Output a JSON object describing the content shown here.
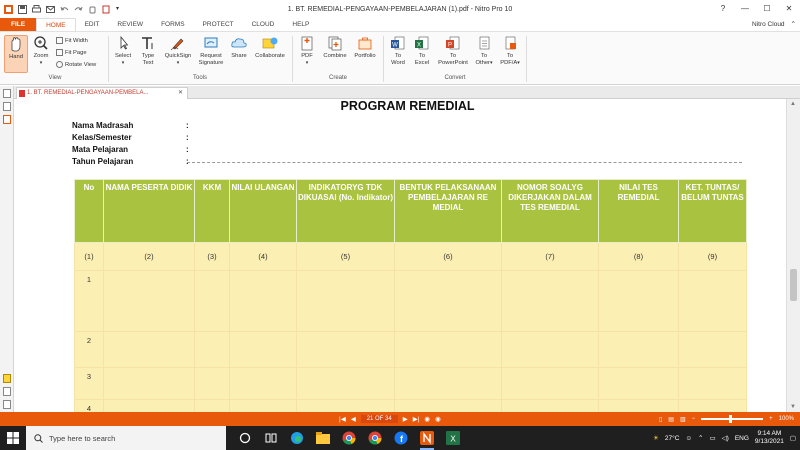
{
  "window": {
    "title": "1. BT. REMEDIAL-PENGAYAAN-PEMBELAJARAN (1).pdf - Nitro Pro 10",
    "account": "Nitro Cloud"
  },
  "ribbon_tabs": [
    "FILE",
    "HOME",
    "EDIT",
    "REVIEW",
    "FORMS",
    "PROTECT",
    "CLOUD",
    "HELP"
  ],
  "ribbon": {
    "view": {
      "hand": "Hand",
      "zoom": "Zoom",
      "fit_width": "Fit Width",
      "fit_page": "Fit Page",
      "rotate_view": "Rotate View",
      "label": "View"
    },
    "tools": {
      "select": "Select",
      "type_text": [
        "Type",
        "Text"
      ],
      "quicksign": "QuickSign",
      "request_signature": [
        "Request",
        "Signature"
      ],
      "share": "Share",
      "collaborate": "Collaborate",
      "label": "Tools"
    },
    "create": {
      "pdf": "PDF",
      "combine": "Combine",
      "portfolio": "Portfolio",
      "label": "Create"
    },
    "convert": {
      "to_word": [
        "To",
        "Word"
      ],
      "to_excel": [
        "To",
        "Excel"
      ],
      "to_powerpoint": [
        "To",
        "PowerPoint"
      ],
      "to_other": [
        "To",
        "Other"
      ],
      "to_pdfa": [
        "To",
        "PDF/A"
      ],
      "label": "Convert"
    }
  },
  "doc_tab": "1. BT. REMEDIAL-PENGAYAAN-PEMBELA...",
  "document": {
    "title": "PROGRAM REMEDIAL",
    "meta": [
      {
        "key": "Nama Madrasah",
        "sep": ":"
      },
      {
        "key": "Kelas/Semester",
        "sep": ":"
      },
      {
        "key": "Mata Pelajaran",
        "sep": ":"
      },
      {
        "key": "Tahun Pelajaran",
        "sep": ":"
      }
    ],
    "table": {
      "headers": [
        "No",
        "NAMA PESERTA DIDIK",
        "KKM",
        "NILAI ULANGAN",
        "INDIKATORYG TDK DIKUASAI (No. Indikator)",
        "BENTUK PELAKSANAAN PEMBELAJARAN RE MEDIAL",
        "NOMOR SOALYG DIKERJAKAN DALAM TES REMEDIAL",
        "NILAI TES REMEDIAL",
        "KET. TUNTAS/ BELUM TUNTAS"
      ],
      "index_row": [
        "(1)",
        "(2)",
        "(3)",
        "(4)",
        "(5)",
        "(6)",
        "(7)",
        "(8)",
        "(9)"
      ],
      "row_numbers": [
        "1",
        "2",
        "3",
        "4"
      ]
    }
  },
  "navigation": {
    "page_indicator": "21 OF 34",
    "zoom": "100%"
  },
  "taskbar": {
    "search_placeholder": "Type here to search",
    "temperature": "27°C",
    "language": "ENG",
    "time": "9:14 AM",
    "date": "9/13/2021"
  }
}
